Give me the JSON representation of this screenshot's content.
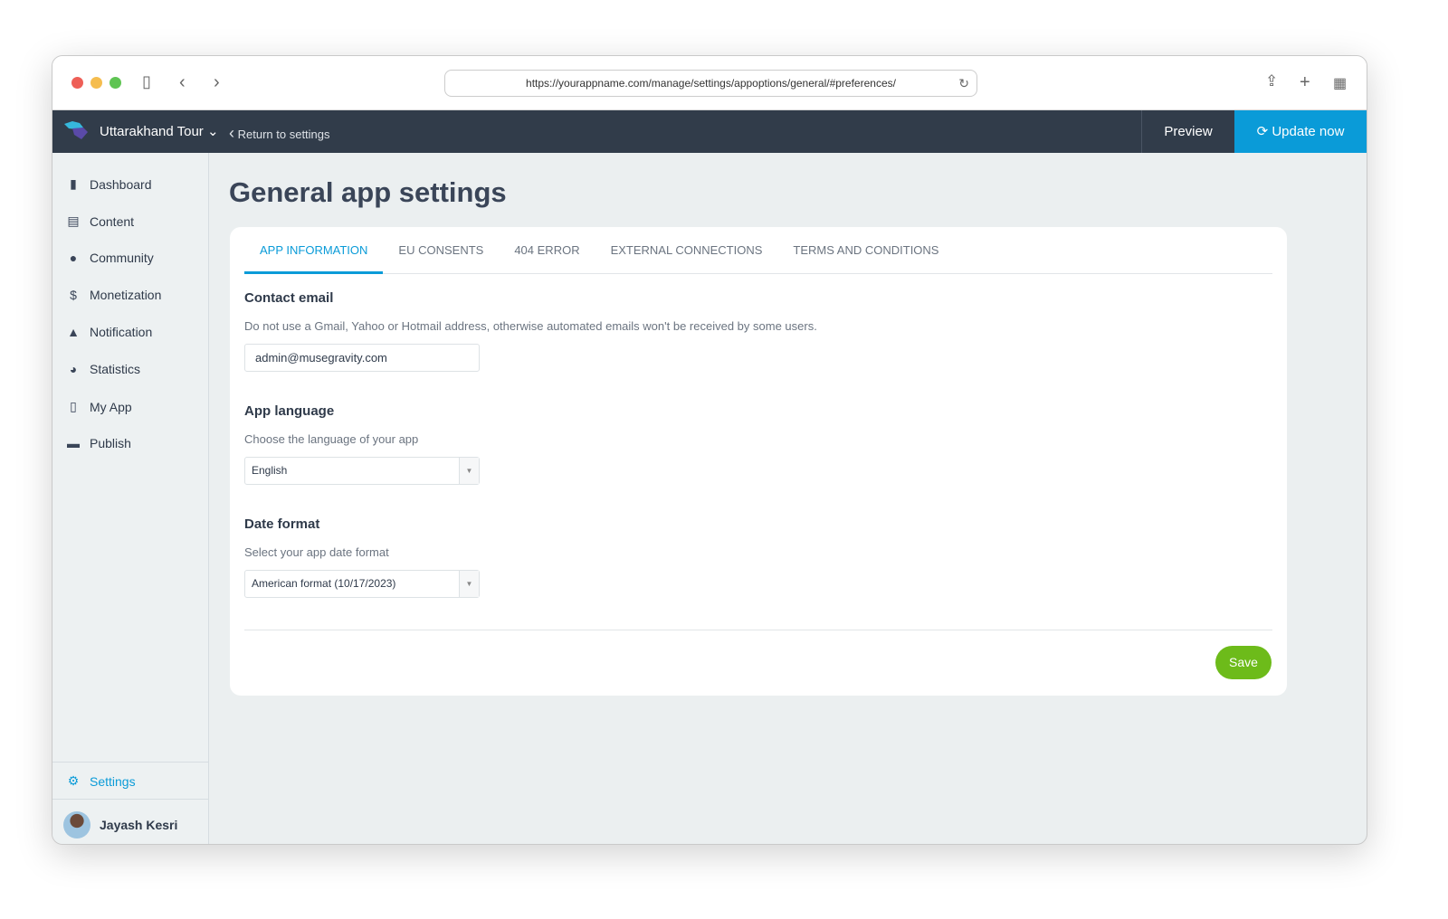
{
  "browser": {
    "url": "https://yourappname.com/manage/settings/appoptions/general/#preferences/"
  },
  "header": {
    "app_name": "Uttarakhand Tour",
    "return_label": "Return to settings",
    "preview_label": "Preview",
    "update_label": "Update now",
    "accent": "#0a9bd8",
    "bg": "#313c4a"
  },
  "sidebar": {
    "items": [
      {
        "label": "Dashboard",
        "icon": "bar-chart-icon"
      },
      {
        "label": "Content",
        "icon": "document-icon"
      },
      {
        "label": "Community",
        "icon": "user-icon"
      },
      {
        "label": "Monetization",
        "icon": "dollar-icon"
      },
      {
        "label": "Notification",
        "icon": "bell-icon"
      },
      {
        "label": "Statistics",
        "icon": "pie-chart-icon"
      },
      {
        "label": "My App",
        "icon": "phone-icon"
      },
      {
        "label": "Publish",
        "icon": "store-icon"
      }
    ],
    "settings_label": "Settings",
    "user_name": "Jayash Kesri"
  },
  "main": {
    "title": "General app settings",
    "tabs": [
      "APP INFORMATION",
      "EU CONSENTS",
      "404 ERROR",
      "EXTERNAL CONNECTIONS",
      "TERMS AND CONDITIONS"
    ],
    "contact": {
      "title": "Contact email",
      "hint": "Do not use a Gmail, Yahoo or Hotmail address, otherwise automated emails won't be received by some users.",
      "value": "admin@musegravity.com"
    },
    "language": {
      "title": "App language",
      "hint": "Choose the language of your app",
      "value": "English"
    },
    "date": {
      "title": "Date format",
      "hint": "Select your app date format",
      "value": "American format (10/17/2023)"
    },
    "save_label": "Save",
    "save_color": "#6dbb1a"
  }
}
